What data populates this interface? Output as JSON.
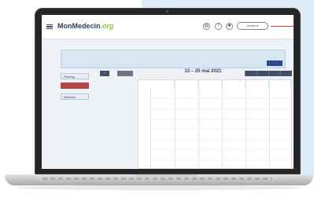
{
  "app": {
    "logo_part1": "MonMedecin",
    "logo_part2": ".org",
    "user_button": "Admin ▾"
  },
  "header": {
    "icons": [
      "printer-icon",
      "help-icon",
      "settings-icon"
    ]
  },
  "info": {
    "lines": [
      "",
      "",
      ""
    ],
    "button": ""
  },
  "sidebar": {
    "items": [
      {
        "label": "Planning",
        "icon": "calendar-icon"
      },
      {
        "label": "",
        "icon": "alert-icon"
      },
      {
        "label": "Médecins",
        "icon": "users-icon"
      }
    ]
  },
  "toolbar": {
    "prev": "<",
    "today": "",
    "title": "13 – 20 mai 2021",
    "views": [
      "",
      "",
      "",
      ""
    ]
  },
  "calendar": {
    "day_headers": [
      "",
      "",
      "",
      "",
      "",
      ""
    ],
    "times": [
      "",
      "",
      "",
      "",
      "",
      "",
      "",
      ""
    ]
  },
  "colors": {
    "accent": "#2d3d6e",
    "brand_green": "#8ac341",
    "alert": "#b74646",
    "info_bg": "#d6e6f3"
  }
}
